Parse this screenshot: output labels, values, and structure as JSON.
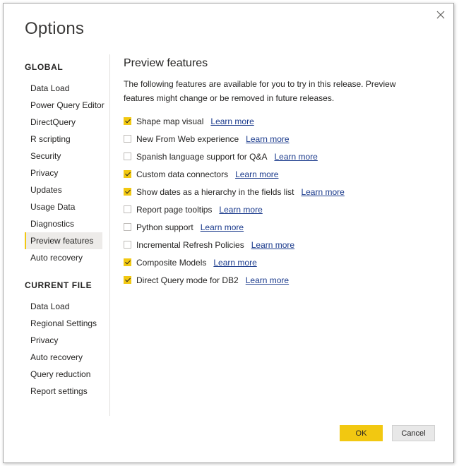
{
  "dialog": {
    "title": "Options",
    "close_icon": "close-icon",
    "ok_label": "OK",
    "cancel_label": "Cancel"
  },
  "sidebar": {
    "global_header": "GLOBAL",
    "global_items": [
      {
        "label": "Data Load"
      },
      {
        "label": "Power Query Editor"
      },
      {
        "label": "DirectQuery"
      },
      {
        "label": "R scripting"
      },
      {
        "label": "Security"
      },
      {
        "label": "Privacy"
      },
      {
        "label": "Updates"
      },
      {
        "label": "Usage Data"
      },
      {
        "label": "Diagnostics"
      },
      {
        "label": "Preview features",
        "selected": true
      },
      {
        "label": "Auto recovery"
      }
    ],
    "current_file_header": "CURRENT FILE",
    "current_file_items": [
      {
        "label": "Data Load"
      },
      {
        "label": "Regional Settings"
      },
      {
        "label": "Privacy"
      },
      {
        "label": "Auto recovery"
      },
      {
        "label": "Query reduction"
      },
      {
        "label": "Report settings"
      }
    ]
  },
  "main": {
    "title": "Preview features",
    "description": "The following features are available for you to try in this release. Preview features might change or be removed in future releases.",
    "learn_more_label": "Learn more",
    "features": [
      {
        "label": "Shape map visual",
        "checked": true
      },
      {
        "label": "New From Web experience",
        "checked": false
      },
      {
        "label": "Spanish language support for Q&A",
        "checked": false
      },
      {
        "label": "Custom data connectors",
        "checked": true
      },
      {
        "label": "Show dates as a hierarchy in the fields list",
        "checked": true
      },
      {
        "label": "Report page tooltips",
        "checked": false
      },
      {
        "label": "Python support",
        "checked": false
      },
      {
        "label": "Incremental Refresh Policies",
        "checked": false
      },
      {
        "label": "Composite Models",
        "checked": true
      },
      {
        "label": "Direct Query mode for DB2",
        "checked": true
      }
    ]
  },
  "colors": {
    "accent": "#f2c811",
    "link": "#1a3a8c",
    "selected_bg": "#edebe9"
  }
}
